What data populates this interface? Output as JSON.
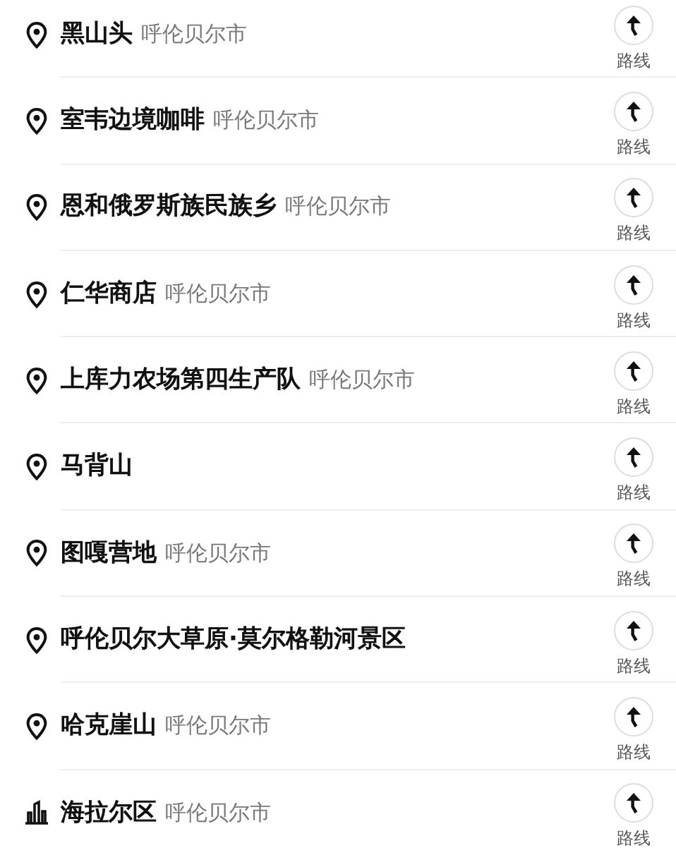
{
  "places": [
    {
      "kind": "pin",
      "name": "黑山头",
      "city": "呼伦贝尔市",
      "action": "路线"
    },
    {
      "kind": "pin",
      "name": "室韦边境咖啡",
      "city": "呼伦贝尔市",
      "action": "路线"
    },
    {
      "kind": "pin",
      "name": "恩和俄罗斯族民族乡",
      "city": "呼伦贝尔市",
      "action": "路线"
    },
    {
      "kind": "pin",
      "name": "仁华商店",
      "city": "呼伦贝尔市",
      "action": "路线"
    },
    {
      "kind": "pin",
      "name": "上库力农场第四生产队",
      "city": "呼伦贝尔市",
      "action": "路线"
    },
    {
      "kind": "pin",
      "name": "马背山",
      "action": "路线"
    },
    {
      "kind": "pin",
      "name": "图嘎营地",
      "city": "呼伦贝尔市",
      "action": "路线"
    },
    {
      "kind": "pin",
      "name": "呼伦贝尔大草原·莫尔格勒河景区",
      "action": "路线"
    },
    {
      "kind": "pin",
      "name": "哈克崖山",
      "city": "呼伦贝尔市",
      "action": "路线"
    },
    {
      "kind": "district",
      "name": "海拉尔区",
      "city": "呼伦贝尔市",
      "action": "路线"
    }
  ]
}
